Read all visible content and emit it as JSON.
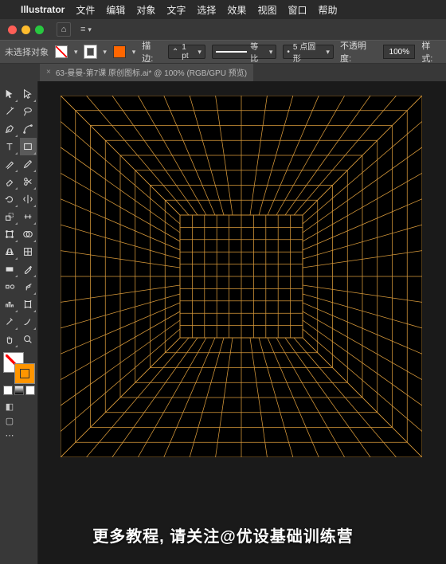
{
  "menubar": {
    "apple": "",
    "app": "Illustrator",
    "items": [
      "文件",
      "编辑",
      "对象",
      "文字",
      "选择",
      "效果",
      "视图",
      "窗口",
      "帮助"
    ]
  },
  "control": {
    "no_selection": "未选择对象",
    "stroke_label": "描边:",
    "stroke_weight": "1 pt",
    "uniform": "等比",
    "profile": "5 点圆形",
    "opacity_label": "不透明度:",
    "opacity": "100%",
    "style_label": "样式:"
  },
  "tab": {
    "title": "63-曼曼-第7课 原创图标.ai* @ 100% (RGB/GPU 预览)",
    "close": "×"
  },
  "caption": "更多教程, 请关注@优设基础训练营",
  "colors": {
    "grid": "#d99a3a",
    "accent": "#ff6600"
  }
}
